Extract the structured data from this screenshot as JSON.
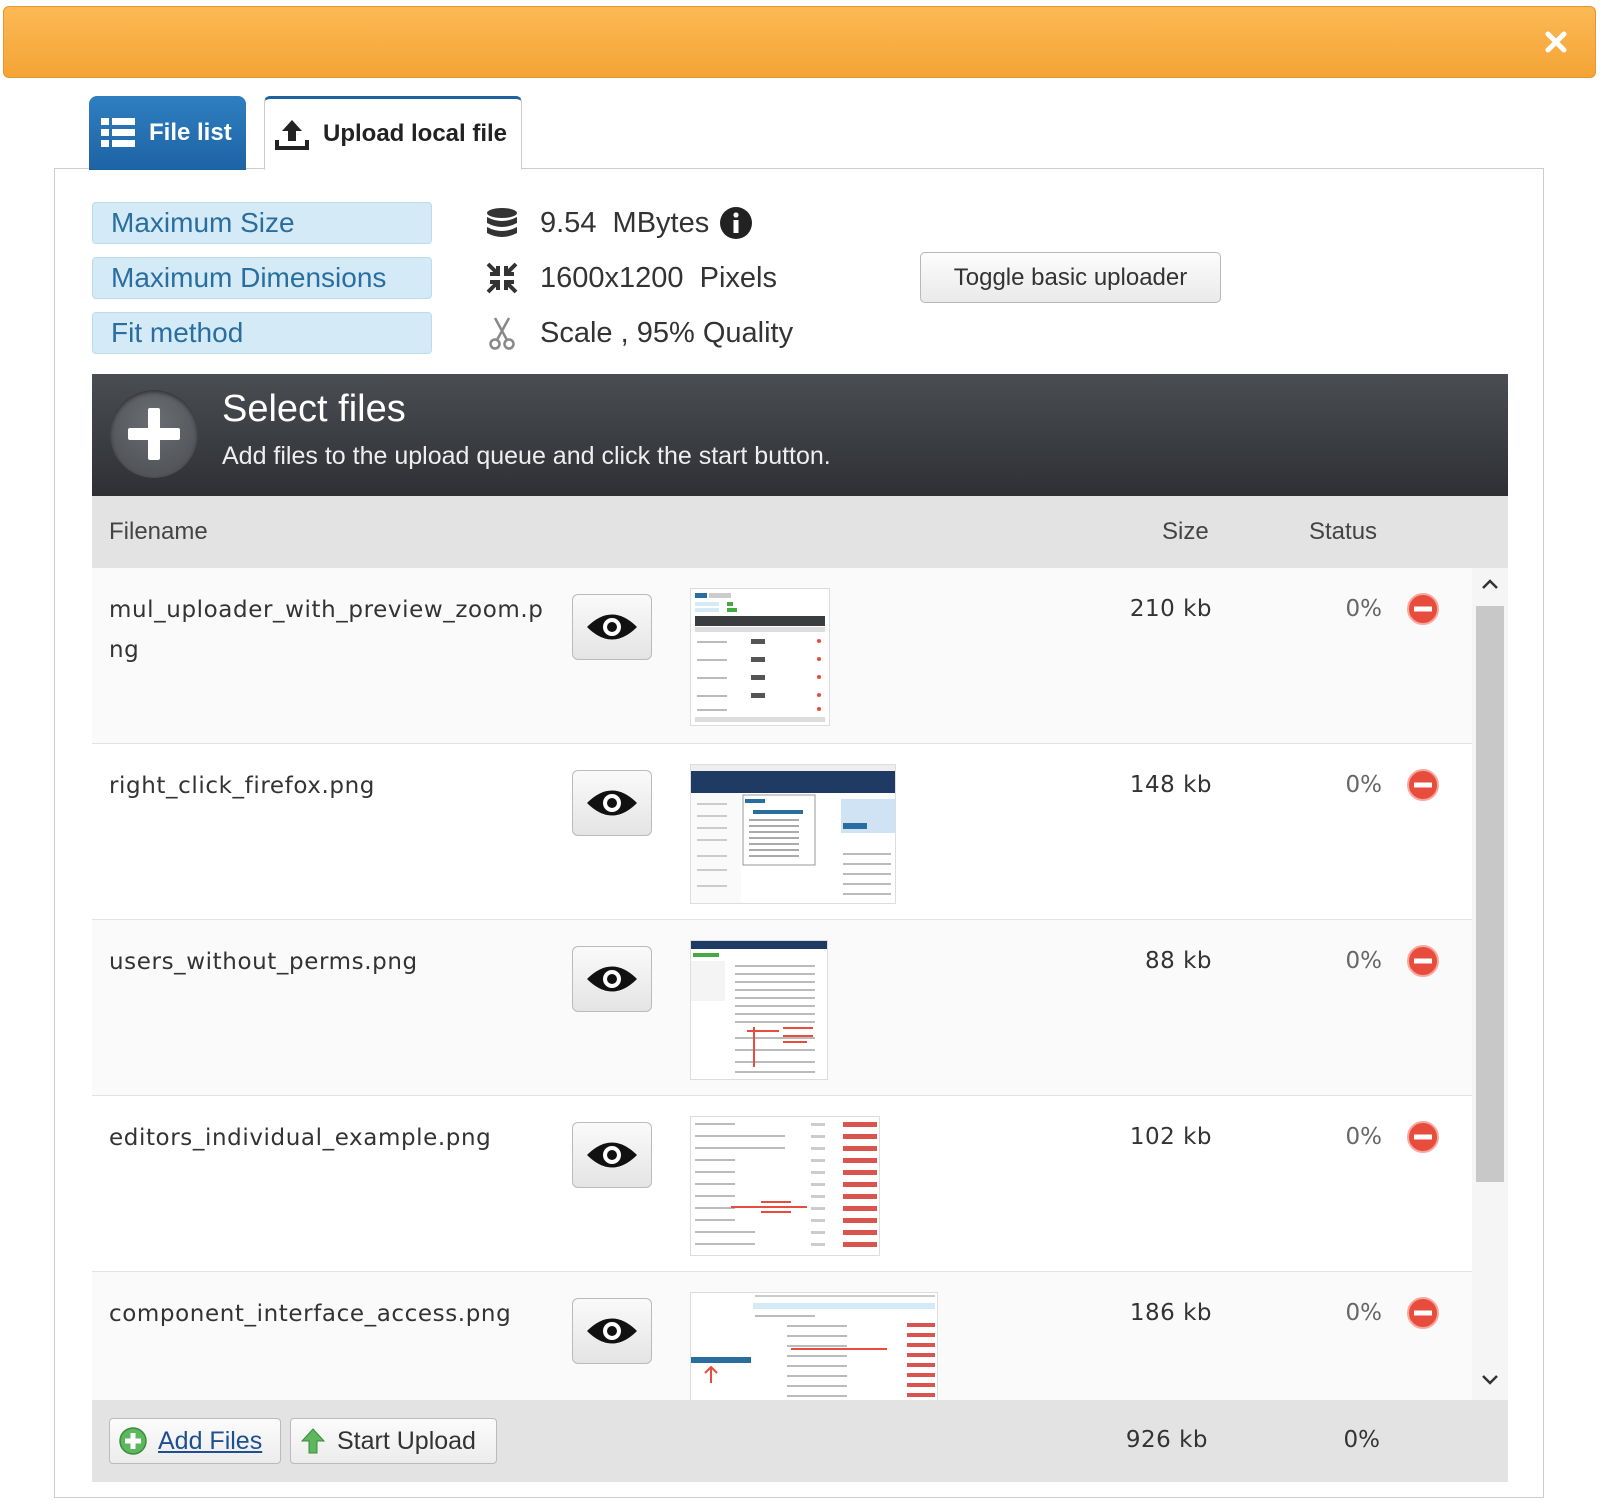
{
  "tabs": [
    {
      "label": "File list",
      "icon": "list-icon",
      "active": true
    },
    {
      "label": "Upload local file",
      "icon": "upload-icon",
      "active": false
    }
  ],
  "limits": {
    "max_size_label": "Maximum Size",
    "max_size_value": "9.54  MBytes",
    "max_dim_label": "Maximum Dimensions",
    "max_dim_value": "1600x1200  Pixels",
    "fit_label": "Fit method",
    "fit_value": "Scale , 95% Quality"
  },
  "toggle_label": "Toggle basic uploader",
  "select": {
    "title": "Select files",
    "subtitle": "Add files to the upload queue and click the start button."
  },
  "columns": {
    "filename": "Filename",
    "size": "Size",
    "status": "Status"
  },
  "files": [
    {
      "name": "mul_uploader_with_preview_zoom.png",
      "size": "210 kb",
      "status": "0%"
    },
    {
      "name": "right_click_firefox.png",
      "size": "148 kb",
      "status": "0%"
    },
    {
      "name": "users_without_perms.png",
      "size": "88 kb",
      "status": "0%"
    },
    {
      "name": "editors_individual_example.png",
      "size": "102 kb",
      "status": "0%"
    },
    {
      "name": "component_interface_access.png",
      "size": "186 kb",
      "status": "0%"
    }
  ],
  "footer": {
    "add_label": "Add Files",
    "start_label": "Start Upload",
    "total_size": "926 kb",
    "total_status": "0%"
  },
  "colors": {
    "topbar": "#f5a435",
    "tab_active": "#1d63a4",
    "label_bg": "#d4ebf7",
    "remove": "#e84c3d"
  }
}
